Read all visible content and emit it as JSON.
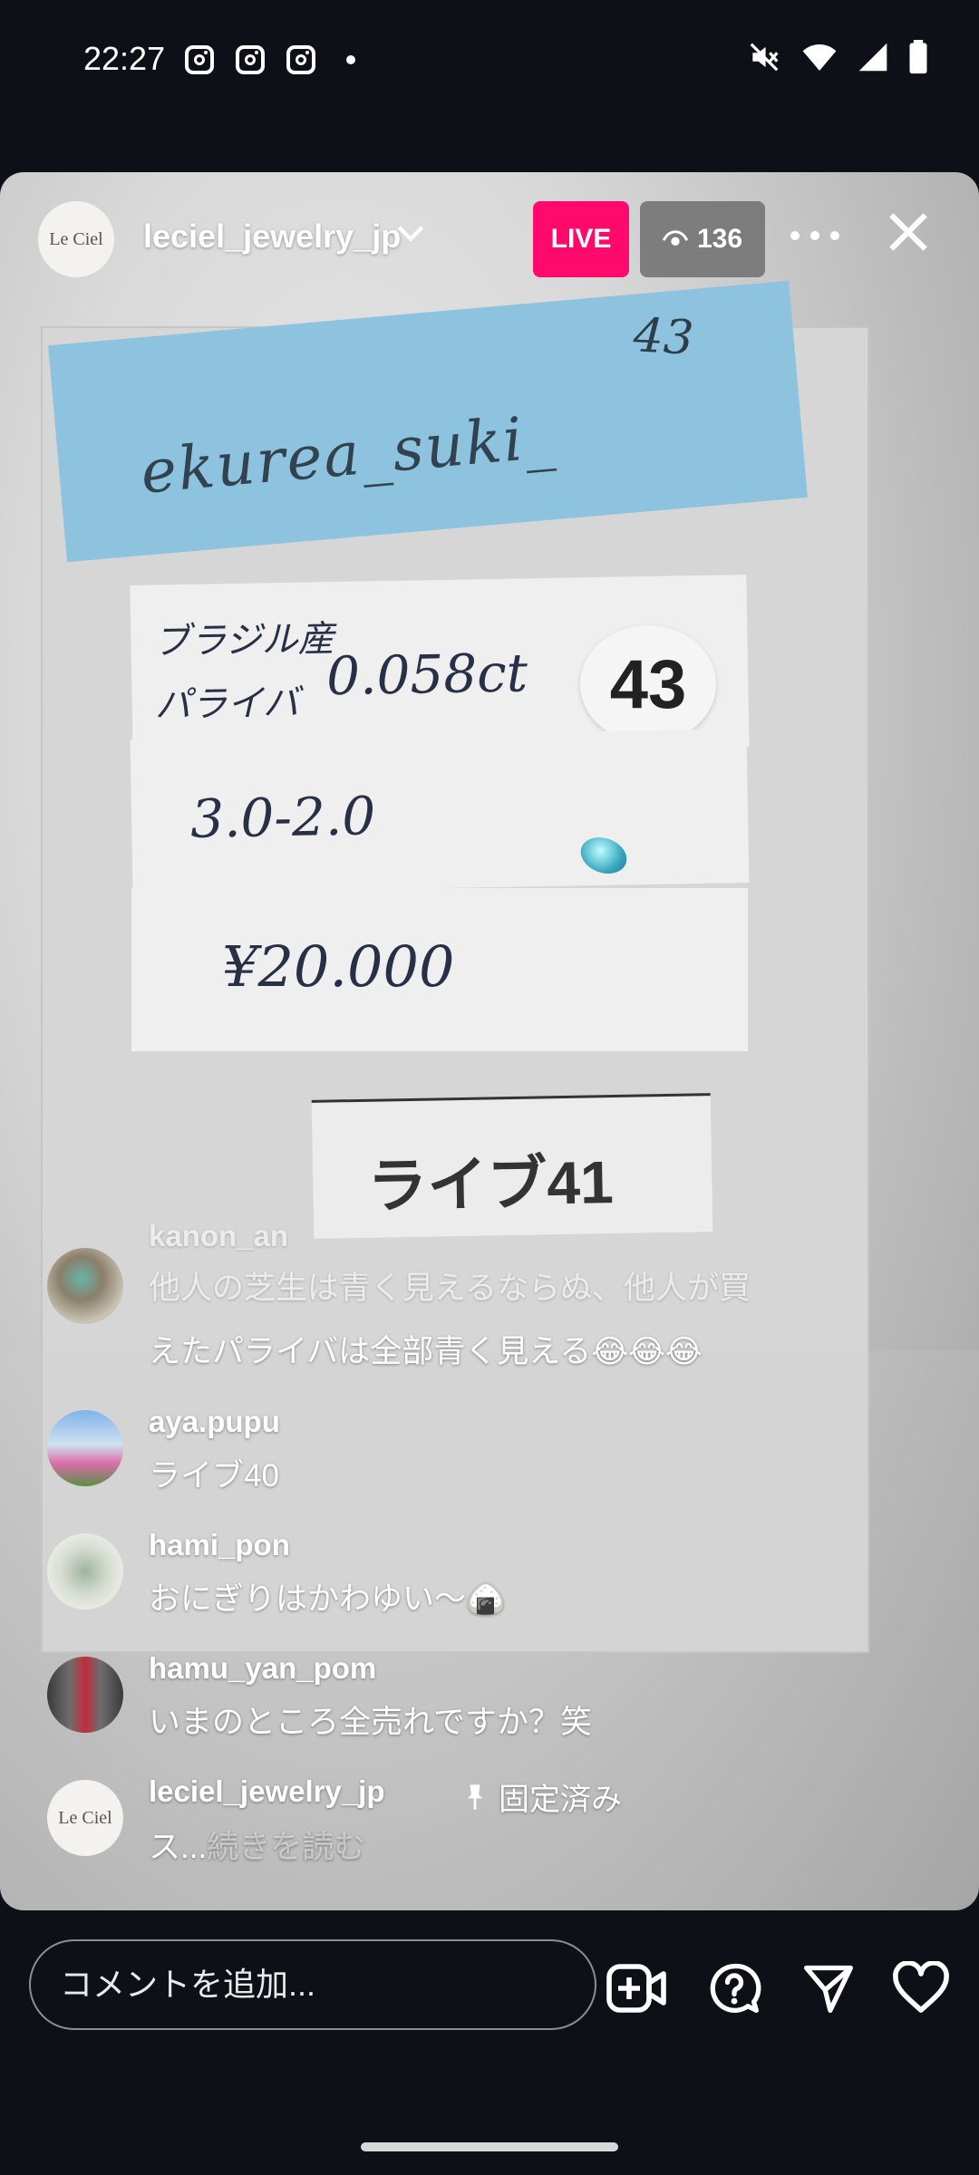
{
  "status_bar": {
    "time": "22:27",
    "left_icons": [
      "instagram-icon",
      "instagram-icon",
      "instagram-icon",
      "notification-dot"
    ],
    "right_icons": [
      "mute-icon",
      "wifi-icon",
      "signal-icon",
      "battery-icon"
    ]
  },
  "header": {
    "host_username": "leciel_jewelry_jp",
    "host_logo_text": "Le Ciel",
    "live_label": "LIVE",
    "viewer_count": "136"
  },
  "stream_content": {
    "sticky_note_name": "ekurea_suki_",
    "sticky_note_number": "43",
    "card1_line1": "ブラジル産",
    "card1_line2": "パライバ",
    "card1_weight": "0.058ct",
    "number_badge": "43",
    "card2_size": "3.0-2.0",
    "card3_price": "¥20.000",
    "live_label_card": "ライブ41"
  },
  "comments": [
    {
      "username": "kanon_an",
      "text_line1": "他人の芝生は青く見えるならぬ、他人が買",
      "text_line2": "えたパライバは全部青く見える😂😂😂"
    },
    {
      "username": "aya.pupu",
      "text": "ライブ40"
    },
    {
      "username": "hami_pon",
      "text": "おにぎりはかわゆい〜🍙"
    },
    {
      "username": "hamu_yan_pom",
      "text": "いまのところ全売れですか？笑"
    },
    {
      "username": "leciel_jewelry_jp",
      "pinned_label": "固定済み",
      "text": "ス...",
      "read_more": "続きを読む"
    }
  ],
  "bottom_bar": {
    "comment_placeholder": "コメントを追加..."
  },
  "colors": {
    "live_badge": "#ff0a6c",
    "background": "#0d1117"
  }
}
